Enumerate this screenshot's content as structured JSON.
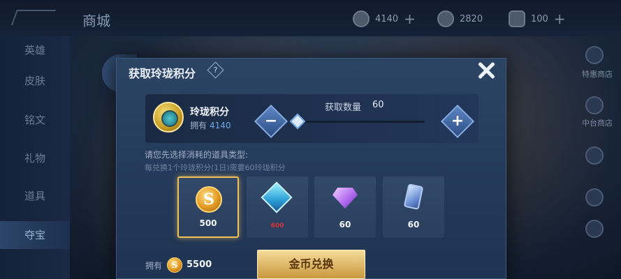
{
  "shop": {
    "title": "商城",
    "currencies": [
      {
        "icon": "coin-icon",
        "value": "4140",
        "plus": "+"
      },
      {
        "icon": "point-icon",
        "value": "2820"
      },
      {
        "icon": "ticket-icon",
        "value": "100",
        "plus": "+"
      }
    ]
  },
  "sidebar": {
    "items": [
      {
        "label": "英雄"
      },
      {
        "label": "皮肤"
      },
      {
        "label": "铭文"
      },
      {
        "label": "礼物"
      },
      {
        "label": "道具"
      },
      {
        "label": "夺宝"
      }
    ]
  },
  "right_panel": {
    "items": [
      {
        "label": "特惠商店",
        "icon": "shop-icon"
      },
      {
        "label": "中台商店",
        "icon": "store-icon"
      }
    ]
  },
  "modal": {
    "title": "获取玲珑积分",
    "help_glyph": "?",
    "item_name": "玲珑积分",
    "owned_label": "拥有",
    "owned_value": "4140",
    "quantity_label": "获取数量",
    "quantity_value": "60",
    "quantity_fill": 0.0,
    "minus_glyph": "−",
    "plus_glyph": "+",
    "prompt_line1": "请您先选择消耗的道具类型:",
    "prompt_line2": "每兑换1个玲珑积分(1日)需要60玲珑积分",
    "options": [
      {
        "name": "coin-option",
        "icon": "gold-coin-icon",
        "glyph": "S",
        "amount": "500",
        "selected": true
      },
      {
        "name": "diamond-option",
        "icon": "diamond-icon",
        "amount": "600",
        "insufficient": true
      },
      {
        "name": "gem-option",
        "icon": "gem-icon",
        "amount": "60"
      },
      {
        "name": "card-option",
        "icon": "crystal-card-icon",
        "amount": "60"
      }
    ],
    "balance_label": "拥有",
    "balance_coin_glyph": "S",
    "balance_value": "5500",
    "exchange_label": "金币兑换"
  },
  "colors": {
    "accent": "#6fa9e8",
    "selected_border": "#f0c25a",
    "insufficient": "#d8353a",
    "button_gold": "#e0b76a"
  }
}
